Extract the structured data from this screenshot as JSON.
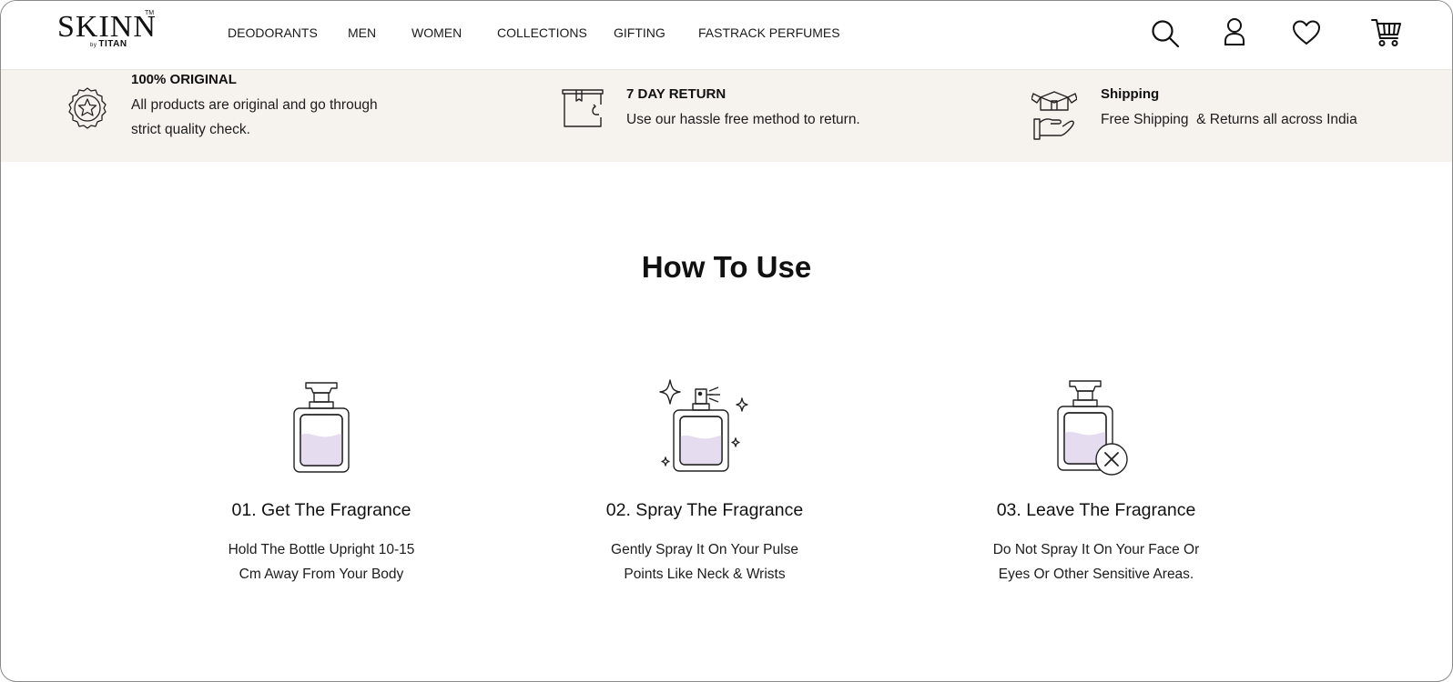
{
  "brand": {
    "logo_main": "SKINN",
    "logo_tm": "TM",
    "logo_by": "by",
    "logo_sub": "TITAN"
  },
  "nav": {
    "items": [
      {
        "label": "DEODORANTS"
      },
      {
        "label": "MEN"
      },
      {
        "label": "WOMEN"
      },
      {
        "label": "COLLECTIONS"
      },
      {
        "label": "GIFTING"
      },
      {
        "label": "FASTRACK PERFUMES"
      }
    ]
  },
  "header_icons": [
    "search-icon",
    "account-icon",
    "wishlist-heart-icon",
    "cart-icon"
  ],
  "benefits": [
    {
      "icon": "quality-badge-icon",
      "title": "100% ORIGINAL",
      "text_line1": "All products are original and go through",
      "text_line2": "strict quality check."
    },
    {
      "icon": "return-box-icon",
      "title": "7 DAY RETURN",
      "text": "Use our hassle free method to return."
    },
    {
      "icon": "shipping-hand-icon",
      "title": "Shipping",
      "text": "Free Shipping  & Returns all across India"
    }
  ],
  "how_to_use": {
    "title": "How To Use",
    "steps": [
      {
        "icon": "perfume-bottle-icon",
        "title": "01. Get The Fragrance",
        "desc_line1": "Hold The Bottle Upright 10-15",
        "desc_line2": "Cm Away From Your Body"
      },
      {
        "icon": "perfume-spray-icon",
        "title": "02. Spray The Fragrance",
        "desc_line1": "Gently Spray It On Your Pulse",
        "desc_line2": "Points Like Neck & Wrists"
      },
      {
        "icon": "perfume-no-face-icon",
        "title": "03. Leave The Fragrance",
        "desc_line1": "Do Not Spray It On Your Face Or",
        "desc_line2": "Eyes Or Other Sensitive Areas."
      }
    ]
  },
  "colors": {
    "strip_background": "#f6f3ee",
    "perfume_fill": "#e6dcf0",
    "text": "#111111"
  }
}
